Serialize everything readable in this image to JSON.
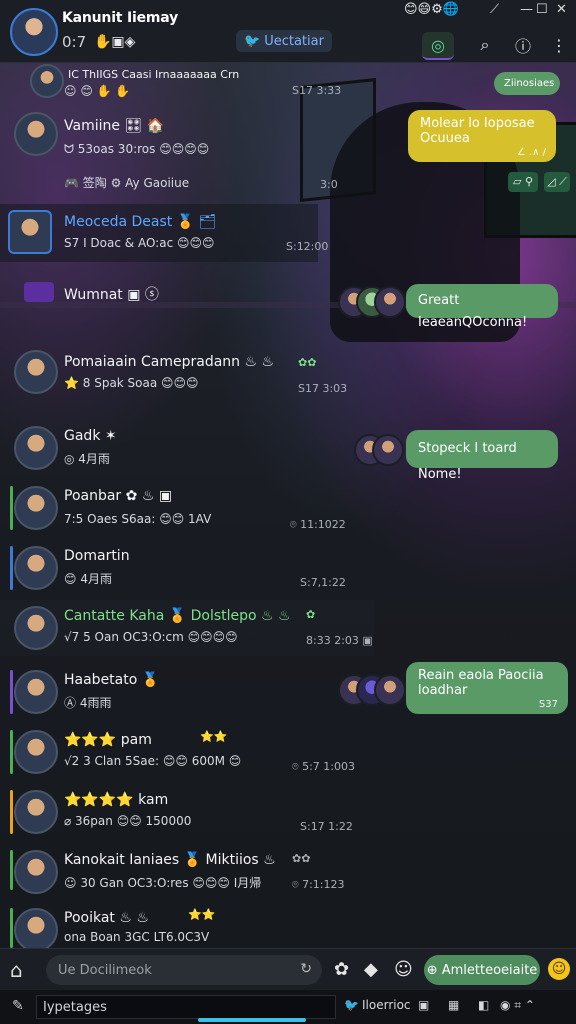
{
  "header": {
    "title": "Kanunit Iiemay",
    "subtitle": "0:7",
    "badges": "✋▣◈",
    "verified_label": "Uectatiar",
    "emoji_strip": "😊😄⚙🌐"
  },
  "window_controls": {
    "minimize": "—",
    "maximize": "☐",
    "close": "✕"
  },
  "top_icons": {
    "chat": "◎",
    "search": "⌕",
    "info": "ⓘ",
    "menu": "⋮"
  },
  "chats": [
    {
      "name": "IC ThIIGS Caasi Irnaaaaaaa Crn",
      "sub": "☺ 😊 ✋ ✋",
      "time": "S17 3:33"
    },
    {
      "name": "Vamiine 🎛 🏠",
      "sub": "ᗢ 53oas 30:ros 😊😊😊😊",
      "meta": "🎮 签陶 ⚙ Ay Gaoiiue",
      "time": "3:0"
    },
    {
      "name": "Meoceda Deast 🏅 🗂",
      "sub": "S7 I Doac & AO:ac 😊😊😊",
      "time": "S:12:00"
    },
    {
      "name": "Wumnat ▣ ⓢ",
      "sub": "",
      "time": ""
    },
    {
      "name": "Pomaiaain Camepradann ♨ ♨",
      "sub": "⭐ 8 Spak Soaa 😊😊😊",
      "time": "S17 3:03",
      "stars": "✿✿"
    },
    {
      "name": "Gadk ✶",
      "sub": "◎ 4月雨",
      "time": ""
    },
    {
      "name": "Poanbar ✿ ♨ ▣",
      "sub": "7:5 Oaes S6aa: 😊😊 1AV",
      "time": "⌾ 11:1022"
    },
    {
      "name": "Domartin",
      "sub": "😊 4月雨",
      "time": "S:7,1:22"
    },
    {
      "name": "Cantatte Kaha 🏅 Dolstlepo ♨ ♨",
      "sub": "√7 5 Oan OC3:O:cm 😊😊😊😊",
      "time": "8:33 2:03 ▣",
      "stars": "✿"
    },
    {
      "name": "Haabetato 🏅",
      "sub": "Ⓐ 4雨雨",
      "time": ""
    },
    {
      "name": "⭐⭐⭐ pam",
      "sub": "√2 3 Clan 5Sae: 😊😊 600M 😊",
      "time": "⌾ 5:7 1:003",
      "stars": "⭐⭐"
    },
    {
      "name": "⭐⭐⭐⭐ kam",
      "sub": "⌀ 36pan 😊😊 150000",
      "time": "S:17 1:22"
    },
    {
      "name": "Kanokait Ianiaes 🏅 Miktiios ♨",
      "sub": "☺ 30 Gan OC3:O:res 😊😊😊 I月帰",
      "time": "⌾ 7:1:123",
      "stars": "✿✿"
    },
    {
      "name": "Pooikat ♨ ♨",
      "sub": "ona Boan 3GC LT6.0C3V",
      "time": "",
      "stars": "⭐⭐"
    }
  ],
  "bubbles": [
    {
      "text": "Ziinosiaes",
      "time": ""
    },
    {
      "text": "Molear lo Ioposae Ocuuea",
      "time": "∠ .∧ /"
    },
    {
      "text": "Greatt IeaeanQOconna!",
      "time": ""
    },
    {
      "text": "Stopeck I toard Nome!",
      "time": ""
    },
    {
      "text": "Reain eaola Paociia loadhar",
      "time": "S37"
    }
  ],
  "bg_buttons": {
    "a": "▱ ⚲",
    "b": "◿ ⟋"
  },
  "composer": {
    "placeholder": "Ue Docilimeok",
    "send_label": "⊕ Amletteoeiaite"
  },
  "taskbar": {
    "search_text": "Iypetages",
    "app1": "Iloerrioc",
    "app2": "",
    "tray": "◉ ⌗ ⌃"
  },
  "colors": {
    "accent_green": "#5a9a67",
    "accent_yellow": "#d6c12d",
    "link_blue": "#5aa8ff",
    "verify_blue": "#7fb2ff"
  }
}
